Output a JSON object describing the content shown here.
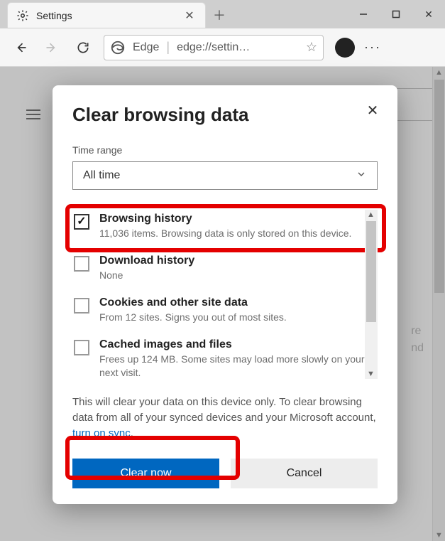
{
  "window": {
    "tab_title": "Settings",
    "newtab_tooltip": "New tab",
    "controls": {
      "min": "Minimize",
      "max": "Maximize",
      "close": "Close"
    }
  },
  "toolbar": {
    "browser_name": "Edge",
    "url_display": "edge://settin…"
  },
  "dialog": {
    "title": "Clear browsing data",
    "time_range_label": "Time range",
    "time_range_value": "All time",
    "options": [
      {
        "key": "browsing-history",
        "title": "Browsing history",
        "subtitle": "11,036 items. Browsing data is only stored on this device.",
        "checked": true
      },
      {
        "key": "download-history",
        "title": "Download history",
        "subtitle": "None",
        "checked": false
      },
      {
        "key": "cookies",
        "title": "Cookies and other site data",
        "subtitle": "From 12 sites. Signs you out of most sites.",
        "checked": false
      },
      {
        "key": "cache",
        "title": "Cached images and files",
        "subtitle": "Frees up 124 MB. Some sites may load more slowly on your next visit.",
        "checked": false
      }
    ],
    "note_prefix": "This will clear your data on this device only. To clear browsing data from all of your synced devices and your Microsoft account, ",
    "note_link": "turn on sync",
    "note_suffix": ".",
    "primary": "Clear now",
    "secondary": "Cancel"
  }
}
